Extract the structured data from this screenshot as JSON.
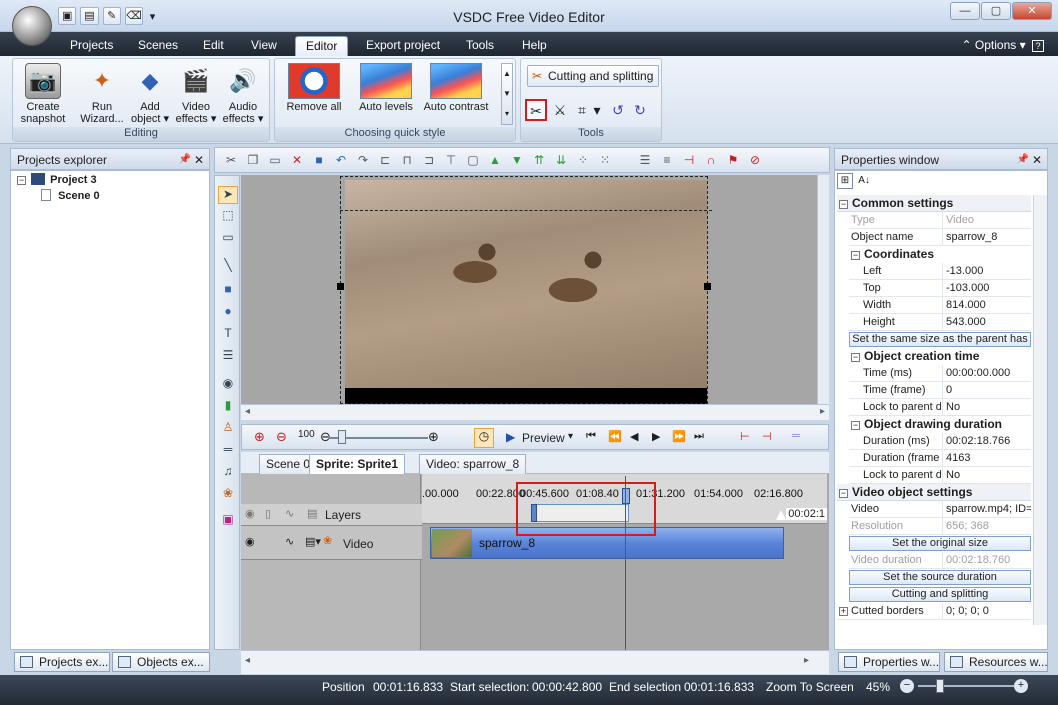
{
  "window": {
    "title": "VSDC Free Video Editor"
  },
  "qat": {
    "items": [
      "new-icon",
      "open-icon",
      "save-icon",
      "undo-icon"
    ],
    "dropdown": "▾"
  },
  "ribbon": {
    "tabs": [
      "Projects",
      "Scenes",
      "Edit",
      "View",
      "Editor",
      "Export project",
      "Tools",
      "Help"
    ],
    "active_tab": "Editor",
    "options_label": "Options",
    "groups": {
      "editing": {
        "label": "Editing",
        "buttons": [
          {
            "label": "Create snapshot",
            "line1": "Create",
            "line2": "snapshot"
          },
          {
            "label": "Run Wizard...",
            "line1": "Run",
            "line2": "Wizard..."
          },
          {
            "label": "Add object",
            "line1": "Add",
            "line2": "object ▾"
          },
          {
            "label": "Video effects",
            "line1": "Video",
            "line2": "effects ▾"
          },
          {
            "label": "Audio effects",
            "line1": "Audio",
            "line2": "effects ▾"
          }
        ]
      },
      "quick_style": {
        "label": "Choosing quick style",
        "buttons": [
          "Remove all",
          "Auto levels",
          "Auto contrast"
        ]
      },
      "tools": {
        "label": "Tools",
        "cutting_label": "Cutting and splitting"
      }
    }
  },
  "projects_explorer": {
    "title": "Projects explorer",
    "tree": [
      {
        "label": "Project 3",
        "level": 0
      },
      {
        "label": "Scene 0",
        "level": 1
      }
    ],
    "bottom_tabs": [
      "Projects ex...",
      "Objects ex..."
    ]
  },
  "timeline": {
    "preview_label": "Preview",
    "tabs": [
      "Scene 0",
      "Sprite: Sprite1",
      "Video: sparrow_8"
    ],
    "active_tab": "Sprite: Sprite1",
    "ruler_labels": [
      ".00.000",
      "00:22.800",
      "00:45.600",
      "01:08.40",
      "01:31.200",
      "01:54.000",
      "02:16.800"
    ],
    "end_label": "00:02:1",
    "layers_label": "Layers",
    "track_label": "Video",
    "clip_label": "sparrow_8"
  },
  "properties": {
    "title": "Properties window",
    "rows": [
      {
        "kind": "cat",
        "label": "Common settings"
      },
      {
        "kind": "row",
        "key": "Type",
        "value": "Video",
        "grey": true
      },
      {
        "kind": "row",
        "key": "Object name",
        "value": "sparrow_8"
      },
      {
        "kind": "sub",
        "label": "Coordinates"
      },
      {
        "kind": "row",
        "key": "Left",
        "value": "-13.000",
        "indent": true
      },
      {
        "kind": "row",
        "key": "Top",
        "value": "-103.000",
        "indent": true
      },
      {
        "kind": "row",
        "key": "Width",
        "value": "814.000",
        "indent": true
      },
      {
        "kind": "row",
        "key": "Height",
        "value": "543.000",
        "indent": true
      },
      {
        "kind": "btn",
        "label": "Set the same size as the parent has"
      },
      {
        "kind": "sub",
        "label": "Object creation time"
      },
      {
        "kind": "row",
        "key": "Time (ms)",
        "value": "00:00:00.000",
        "indent": true
      },
      {
        "kind": "row",
        "key": "Time (frame)",
        "value": "0",
        "indent": true
      },
      {
        "kind": "row",
        "key": "Lock to parent d",
        "value": "No",
        "indent": true
      },
      {
        "kind": "sub",
        "label": "Object drawing duration"
      },
      {
        "kind": "row",
        "key": "Duration (ms)",
        "value": "00:02:18.766",
        "indent": true
      },
      {
        "kind": "row",
        "key": "Duration (frame",
        "value": "4163",
        "indent": true
      },
      {
        "kind": "row",
        "key": "Lock to parent d",
        "value": "No",
        "indent": true
      },
      {
        "kind": "cat",
        "label": "Video object settings"
      },
      {
        "kind": "row",
        "key": "Video",
        "value": "sparrow.mp4; ID="
      },
      {
        "kind": "row",
        "key": "Resolution",
        "value": "656; 368",
        "grey": true
      },
      {
        "kind": "btn",
        "label": "Set the original size"
      },
      {
        "kind": "row",
        "key": "Video duration",
        "value": "00:02:18.760",
        "grey": true
      },
      {
        "kind": "btn",
        "label": "Set the source duration"
      },
      {
        "kind": "btn",
        "label": "Cutting and splitting"
      },
      {
        "kind": "catplus",
        "label": "Cutted borders",
        "value": "0; 0; 0; 0"
      }
    ],
    "bottom_tabs": [
      "Properties w...",
      "Resources w..."
    ]
  },
  "status": {
    "position_label": "Position",
    "position_value": "00:01:16.833",
    "start_label": "Start selection:",
    "start_value": "00:00:42.800",
    "end_label": "End selection",
    "end_value": "00:01:16.833",
    "zoom_label": "Zoom To Screen",
    "zoom_value": "45%",
    "zoom_level": 0.45
  }
}
